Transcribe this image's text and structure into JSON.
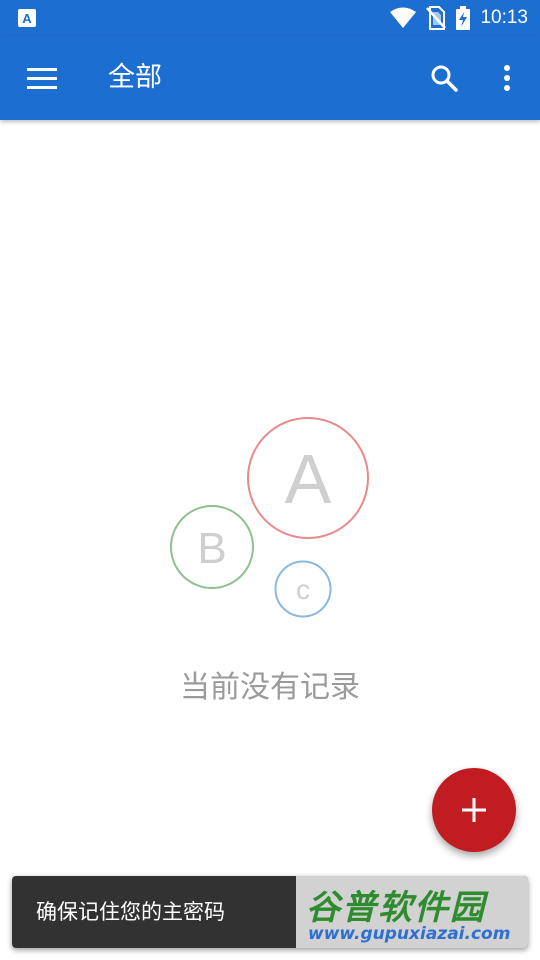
{
  "status_bar": {
    "app_icon_letter": "A",
    "time": "10:13"
  },
  "app_bar": {
    "title": "全部"
  },
  "empty_state": {
    "circle_a": "A",
    "circle_b": "B",
    "circle_c": "c",
    "message": "当前没有记录"
  },
  "fab": {
    "label": "+"
  },
  "snackbar": {
    "message": "确保记住您的主密码"
  },
  "watermark": {
    "title": "谷普软件园",
    "url": "www.gupuxiazai.com"
  },
  "colors": {
    "primary": "#1c6fd1",
    "fab": "#c01c22",
    "circle_a": "#e88a8a",
    "circle_b": "#8fc08f",
    "circle_c": "#8ab8e0",
    "empty_text": "#9a9a9a"
  }
}
